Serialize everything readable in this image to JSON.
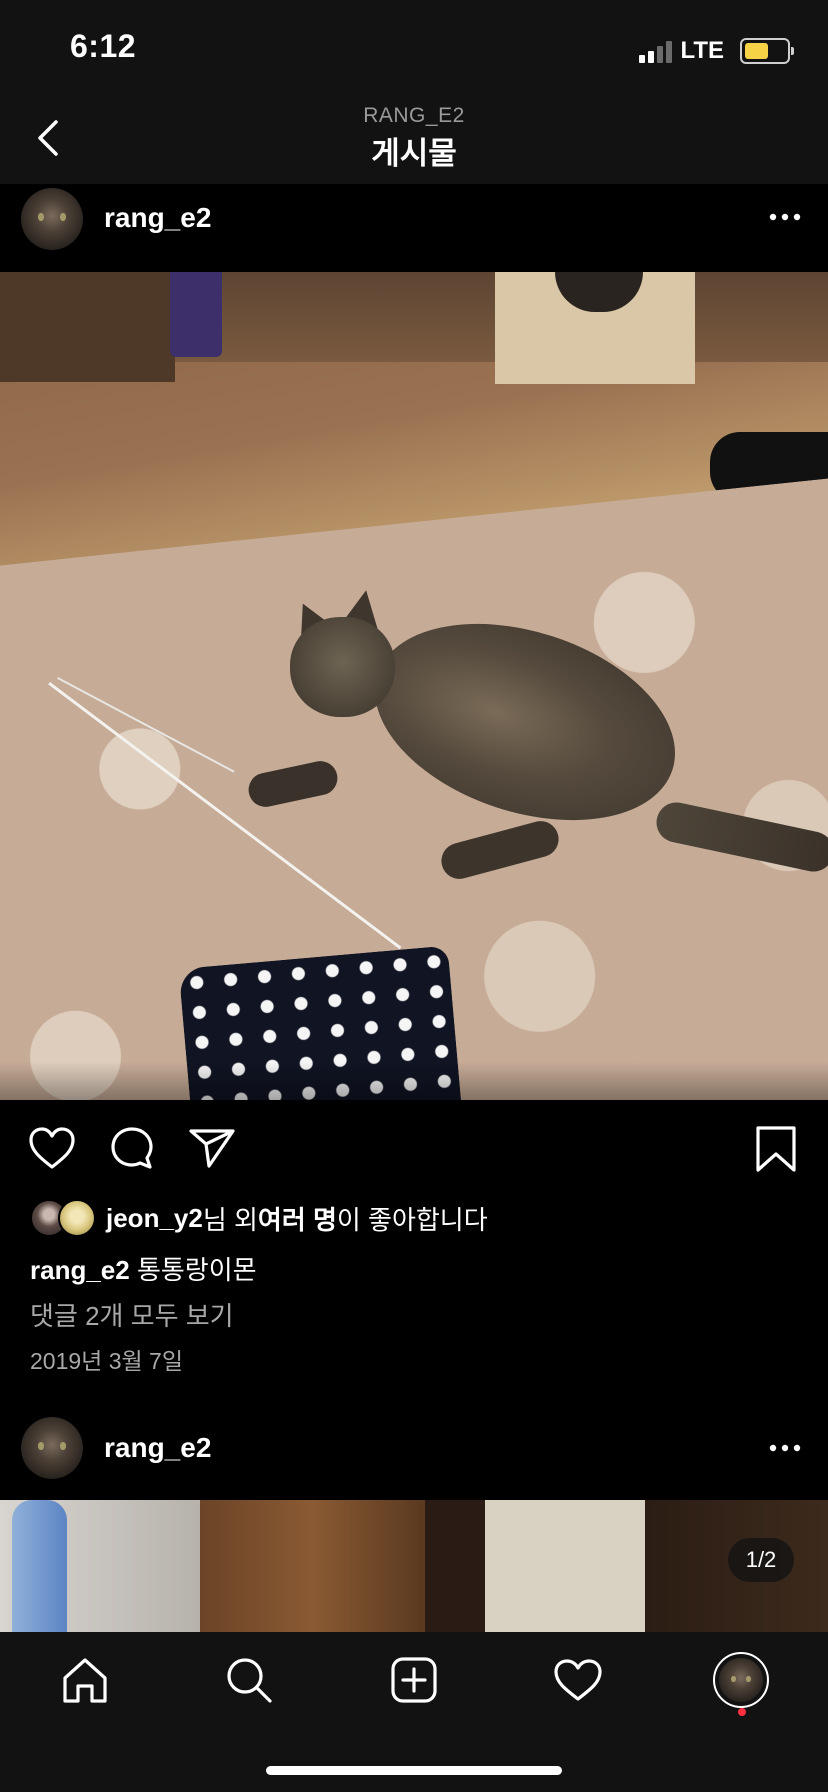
{
  "status": {
    "time": "6:12",
    "network": "LTE"
  },
  "nav": {
    "subtitle": "RANG_E2",
    "title": "게시물"
  },
  "post": {
    "username": "rang_e2",
    "likes": {
      "user": "jeon_y2",
      "suffix1": "님 외 ",
      "bold_text": "여러 명",
      "suffix2": "이 좋아합니다"
    },
    "caption": {
      "username": "rang_e2",
      "text": " 통통랑이몬"
    },
    "comments_link": "댓글 2개 모두 보기",
    "date": "2019년 3월 7일"
  },
  "next_post": {
    "username": "rang_e2",
    "counter": "1/2"
  },
  "icons": {
    "back": "chevron-left-icon",
    "more": "more-horizontal-icon",
    "like": "heart-outline-icon",
    "comment": "comment-bubble-icon",
    "share": "send-paper-plane-icon",
    "save": "bookmark-icon",
    "tabs": [
      "home-icon",
      "search-icon",
      "add-post-icon",
      "activity-heart-icon",
      "profile-avatar"
    ]
  },
  "colors": {
    "background": "#000000",
    "bar": "#121212",
    "secondary_text": "#a8a8a8",
    "battery": "#f6d246",
    "notification_dot": "#ff3040"
  }
}
